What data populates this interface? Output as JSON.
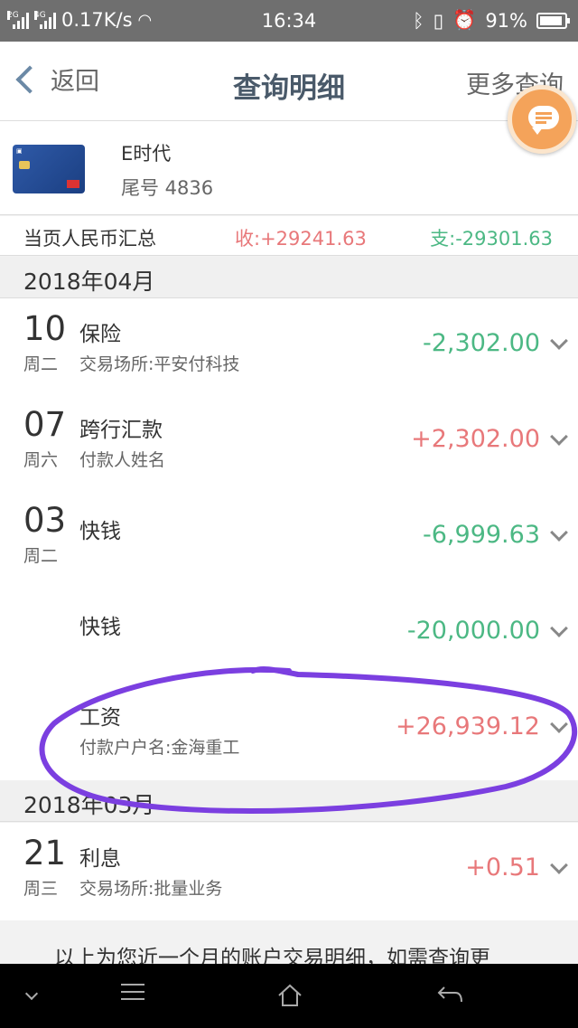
{
  "status_bar": {
    "net_left": "2G",
    "net_right": "4G",
    "speed": "0.17K/s",
    "time": "16:34",
    "battery": "91%",
    "battery_level": 0.91
  },
  "nav": {
    "back_label": "返回",
    "title": "查询明细",
    "more_label": "更多查询"
  },
  "card": {
    "name": "E时代",
    "tail_number": "尾号 4836"
  },
  "summary": {
    "label": "当页人民币汇总",
    "income": "收:+29241.63",
    "expense": "支:-29301.63"
  },
  "months": [
    {
      "label": "2018年04月",
      "transactions": [
        {
          "day": "10",
          "weekday": "周二",
          "title": "保险",
          "detail": "交易场所:平安付科技",
          "amount": "-2,302.00",
          "direction": "out"
        },
        {
          "day": "07",
          "weekday": "周六",
          "title": "跨行汇款",
          "detail": "付款人姓名",
          "amount": "+2,302.00",
          "direction": "in"
        },
        {
          "day": "03",
          "weekday": "周二",
          "title": "快钱",
          "detail": "",
          "amount": "-6,999.63",
          "direction": "out"
        },
        {
          "day": "",
          "weekday": "",
          "title": "快钱",
          "detail": "",
          "amount": "-20,000.00",
          "direction": "out"
        },
        {
          "day": "",
          "weekday": "",
          "title": "工资",
          "detail": "付款户户名:金海重工",
          "amount": "+26,939.12",
          "direction": "in"
        }
      ]
    },
    {
      "label": "2018年03月",
      "transactions": [
        {
          "day": "21",
          "weekday": "周三",
          "title": "利息",
          "detail": "交易场所:批量业务",
          "amount": "+0.51",
          "direction": "in"
        }
      ]
    }
  ],
  "footer_note": "以上为您近一个月的账户交易明细，如需查询更",
  "colors": {
    "income": "#e8787a",
    "expense": "#4cb884",
    "annotation": "#7b3fe0",
    "fab": "#f4a35a"
  }
}
